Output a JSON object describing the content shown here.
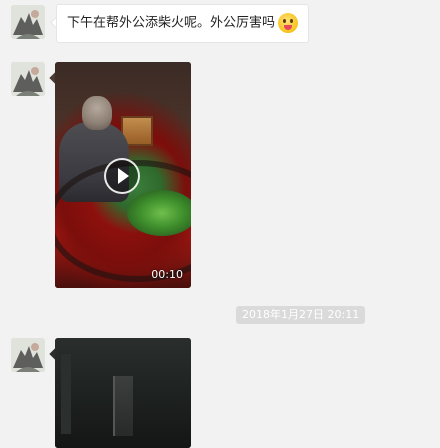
{
  "messages": [
    {
      "type": "text",
      "text": "下午在帮外公添柴火呢。外公厉害吗",
      "emoji": "tongue-out-emoji"
    },
    {
      "type": "video",
      "duration": "00:10",
      "play_icon": "play-icon"
    },
    {
      "type": "timestamp",
      "text": "2018年1月27日 20:11"
    },
    {
      "type": "video",
      "partial": true
    }
  ]
}
